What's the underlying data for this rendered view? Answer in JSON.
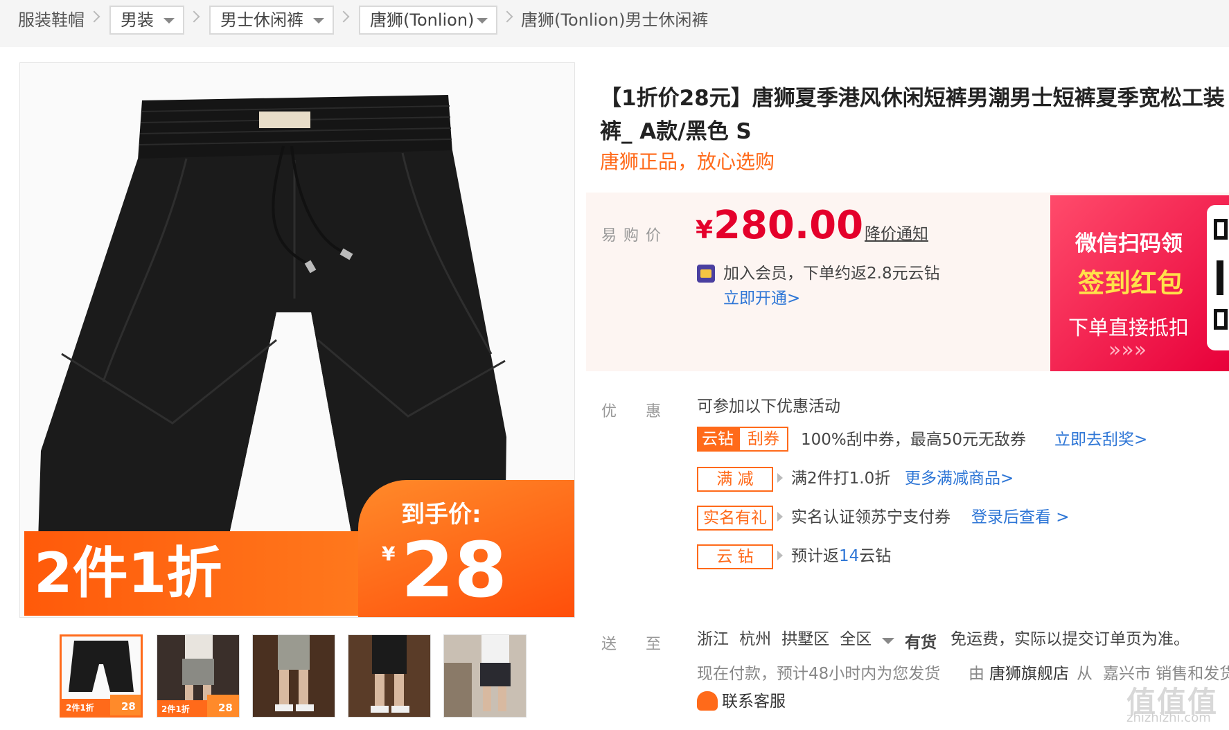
{
  "breadcrumb": {
    "root": "服装鞋帽",
    "category": "男装",
    "subcategory": "男士休闲裤",
    "brand": "唐狮(Tonlion)",
    "current": "唐狮(Tonlion)男士休闲裤"
  },
  "gallery": {
    "promo_left": "2件1折",
    "promo_right_label": "到手价:",
    "promo_currency": "¥",
    "promo_price": "28",
    "thumb_mini_left": "2件1折",
    "thumb_mini_right": "28"
  },
  "product": {
    "title": "【1折价28元】唐狮夏季港风休闲短裤男潮男士短裤夏季宽松工装裤_ A款/黑色 S",
    "subtitle": "唐狮正品，放心选购"
  },
  "price": {
    "label": "易购价",
    "currency": "¥",
    "value": "280.00",
    "notify_link": "降价通知",
    "member_text": "加入会员，下单约返2.8元云钻",
    "member_link": "立即开通>"
  },
  "banner": {
    "line1": "微信扫码领",
    "line2": "签到红包",
    "line3": "下单直接抵扣",
    "arrows": "»»»"
  },
  "promotions": {
    "label": "优　惠",
    "intro": "可参加以下优惠活动",
    "items": [
      {
        "tag1": "云钻",
        "tag2": "刮券",
        "text": "100%刮中券，最高50元无敌券",
        "link": "立即去刮奖>"
      },
      {
        "tag": "满 减",
        "text": "满2件打1.0折",
        "link": "更多满减商品>"
      },
      {
        "tag": "实名有礼",
        "text": "实名认证领苏宁支付券",
        "link": "登录后查看 >"
      },
      {
        "tag": "云 钻",
        "text_before": "预计返",
        "highlight": "14",
        "text_after": "云钻"
      }
    ]
  },
  "delivery": {
    "label": "送　至",
    "province": "浙江",
    "city": "杭州",
    "district": "拱墅区",
    "area": "全区",
    "stock": "有货",
    "shipping": "免运费，实际以提交订单页为准。",
    "dispatch": "现在付款，预计48小时内为您发货",
    "by": "由",
    "store": "唐狮旗舰店",
    "from": "从",
    "origin": "嘉兴市 销售和发货",
    "service": "联系客服"
  },
  "watermark": {
    "text": "zhizhizhi.com",
    "logo": "值值值"
  },
  "colors": {
    "accent": "#ff6a1a",
    "price_red": "#e4002b",
    "link_blue": "#2e76d6"
  }
}
